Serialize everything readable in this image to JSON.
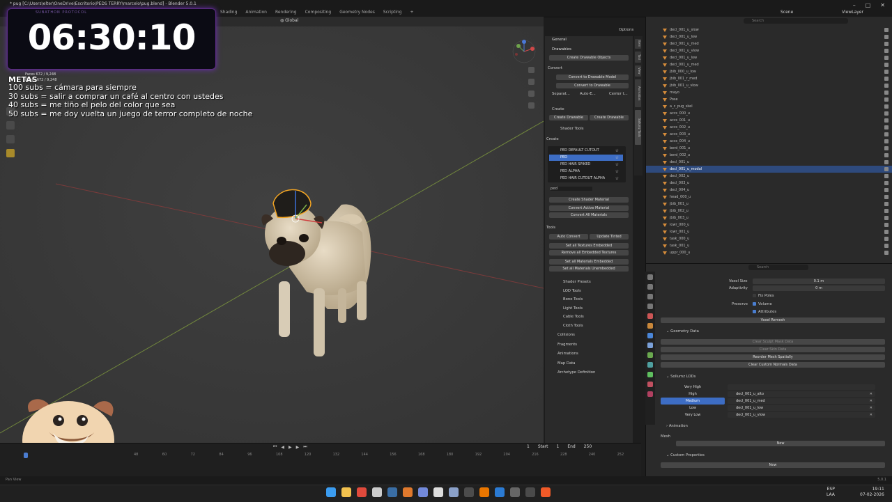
{
  "window": {
    "title": "* pug [C:\\Users\\elter\\OneDrive\\Escritorio\\PEDS TERRY\\marcelo\\pug.blend] - Blender 5.0.1",
    "menus": [
      "Shading",
      "Animation",
      "Rendering",
      "Compositing",
      "Geometry Nodes",
      "Scripting",
      "+"
    ],
    "scene": "Scene",
    "view_layer": "ViewLayer"
  },
  "overlay": {
    "timer": "06:30:10",
    "timer_caption": "SUBATHON PROTOCOL",
    "metas_title": "METAS",
    "metas": [
      "100 subs = cámara para siempre",
      "30 subs = salir a comprar un café al centro con ustedes",
      "40 subs = me tiño el pelo del color que sea",
      "50 subs = me doy vuelta un juego de terror completo de noche"
    ],
    "stats": [
      "Faces    672 / 9,248",
      "Edges   672 / 9,248"
    ]
  },
  "viewport": {
    "orientation": "Global",
    "options": "Options",
    "status_left": "Pan View"
  },
  "npanel": {
    "general": "General",
    "drawables": "Drawables",
    "create_drawable_objects": "Create Drawable Objects",
    "convert": "Convert",
    "convert_to_drawable_model": "Convert to Drawable Model",
    "convert_to_drawable": "Convert to Drawable",
    "separate": "Separat...",
    "auto_e": "Auto-E...",
    "center": "Center t...",
    "create": "Create",
    "create_drawable": "Create Drawable",
    "create_drawable2": "Create Drawable",
    "shader_tools": "Shader Tools",
    "create_label": "Create",
    "shader_list": [
      "PED DEFAULT CUTOUT",
      "PED",
      "PED HAIR SPIKED",
      "PED ALPHA",
      "PED HAIR CUTOUT ALPHA"
    ],
    "search_value": "ped",
    "create_shader_material": "Create Shader Material",
    "convert_active_material": "Convert Active Material",
    "convert_all_materials": "Convert All Materials",
    "tools": "Tools",
    "auto_convert": "Auto Convert",
    "update_tinted": "Update Tinted",
    "set_all_textures_embedded": "Set all Textures Embedded",
    "remove_all_embedded": "Remove all Embedded Textures",
    "set_all_materials_embedded": "Set all Materials Embedded",
    "set_all_materials_unembedded": "Set all Materials Unembedded",
    "subpanels": [
      "Shader Presets",
      "LOD Tools",
      "Bone Tools",
      "Light Tools",
      "Cable Tools",
      "Cloth Tools"
    ],
    "sections": [
      "Collisions",
      "Fragments",
      "Animations",
      "Map Data",
      "Archetype Definition"
    ],
    "side_tabs": [
      "Item",
      "Tool",
      "View",
      "Animation",
      "Sollumz Tools"
    ]
  },
  "outliner": {
    "rows": [
      {
        "name": "decl_001_u_slow",
        "sel": false
      },
      {
        "name": "decl_001_u_low",
        "sel": false
      },
      {
        "name": "decl_001_u_med",
        "sel": false
      },
      {
        "name": "decl_001_u_vlow",
        "sel": false
      },
      {
        "name": "decl_001_u_low",
        "sel": false
      },
      {
        "name": "decl_001_u_med",
        "sel": false
      },
      {
        "name": "jbib_000_u_low",
        "sel": false
      },
      {
        "name": "jbib_001_r_med",
        "sel": false
      },
      {
        "name": "jbib_001_u_vlow",
        "sel": false
      },
      {
        "name": "mayo",
        "sel": false
      },
      {
        "name": "Pose",
        "sel": false
      },
      {
        "name": "a_c_pug_skel",
        "sel": false
      },
      {
        "name": "accs_000_u",
        "sel": false
      },
      {
        "name": "accs_001_u",
        "sel": false
      },
      {
        "name": "accs_002_u",
        "sel": false
      },
      {
        "name": "accs_003_u",
        "sel": false
      },
      {
        "name": "accs_004_u",
        "sel": false
      },
      {
        "name": "berd_001_u",
        "sel": false
      },
      {
        "name": "berd_002_u",
        "sel": false
      },
      {
        "name": "decl_001_u",
        "sel": false
      },
      {
        "name": "decl_001_u_modal",
        "sel": true
      },
      {
        "name": "decl_002_u",
        "sel": false
      },
      {
        "name": "decl_003_u",
        "sel": false
      },
      {
        "name": "decl_004_u",
        "sel": false
      },
      {
        "name": "head_000_u",
        "sel": false
      },
      {
        "name": "jbib_001_u",
        "sel": false
      },
      {
        "name": "jbib_002_u",
        "sel": false
      },
      {
        "name": "jbib_003_u",
        "sel": false
      },
      {
        "name": "lowr_000_u",
        "sel": false
      },
      {
        "name": "lowr_001_u",
        "sel": false
      },
      {
        "name": "task_000_u",
        "sel": false
      },
      {
        "name": "task_001_u",
        "sel": false
      },
      {
        "name": "uppr_000_u",
        "sel": false
      }
    ],
    "search_placeholder": "Search"
  },
  "properties": {
    "search_placeholder": "Search",
    "voxel_size_label": "Voxel Size",
    "voxel_size": "0.1 m",
    "adaptivity_label": "Adaptivity",
    "adaptivity": "0 m",
    "fix_poles": "Fix Poles",
    "preserve_label": "Preserve",
    "volume": "Volume",
    "attributes": "Attributes",
    "voxel_remesh": "Voxel Remesh",
    "geometry_data": "Geometry Data",
    "clear_sculpt_mask": "Clear Sculpt Mask Data",
    "clear_skin_data": "Clear Skin Data",
    "reorder_mesh_sparsity": "Reorder Mesh Spatially",
    "clear_custom_normals": "Clear Custom Normals Data",
    "sollumz_lods": "Sollumz LODs",
    "lods": [
      {
        "level": "Very High",
        "mesh": "",
        "sel": false
      },
      {
        "level": "High",
        "mesh": "decl_001_u_alto",
        "sel": false
      },
      {
        "level": "Medium",
        "mesh": "decl_001_u_med",
        "sel": true
      },
      {
        "level": "Low",
        "mesh": "decl_001_u_low",
        "sel": false
      },
      {
        "level": "Very Low",
        "mesh": "decl_001_u_vlow",
        "sel": false
      }
    ],
    "animation": "Animation",
    "mesh_label": "Mesh",
    "new1": "New",
    "custom_properties": "Custom Properties",
    "new2": "New"
  },
  "timeline": {
    "frame": "1",
    "start_label": "Start",
    "start": "1",
    "end_label": "End",
    "end": "250",
    "ruler": [
      "48",
      "60",
      "72",
      "84",
      "96",
      "108",
      "120",
      "132",
      "144",
      "156",
      "168",
      "180",
      "192",
      "204",
      "216",
      "228",
      "240",
      "252"
    ]
  },
  "taskbar": {
    "lang": "ESP",
    "lang2": "LAA",
    "time": "19:11",
    "date": "07-02-2026",
    "version": "5.0.1",
    "icons": [
      {
        "name": "windows-icon",
        "color": "#3b9cf0"
      },
      {
        "name": "file-explorer-icon",
        "color": "#f2c14e"
      },
      {
        "name": "chrome-icon",
        "color": "#e04a3c"
      },
      {
        "name": "github-icon",
        "color": "#cccccc"
      },
      {
        "name": "steam-icon",
        "color": "#3a6ea5"
      },
      {
        "name": "artstation-icon",
        "color": "#e0792d"
      },
      {
        "name": "discord-icon",
        "color": "#7289da"
      },
      {
        "name": "cursor-icon",
        "color": "#dddddd"
      },
      {
        "name": "settings-icon",
        "color": "#8aa0c8"
      },
      {
        "name": "terminal-icon",
        "color": "#4c4c4c"
      },
      {
        "name": "blender-icon",
        "color": "#ea7600"
      },
      {
        "name": "vscode-icon",
        "color": "#2b7bd4"
      },
      {
        "name": "word-icon",
        "color": "#666666"
      },
      {
        "name": "obs-icon",
        "color": "#4a4a4a"
      },
      {
        "name": "brave-icon",
        "color": "#f05a28"
      }
    ]
  }
}
